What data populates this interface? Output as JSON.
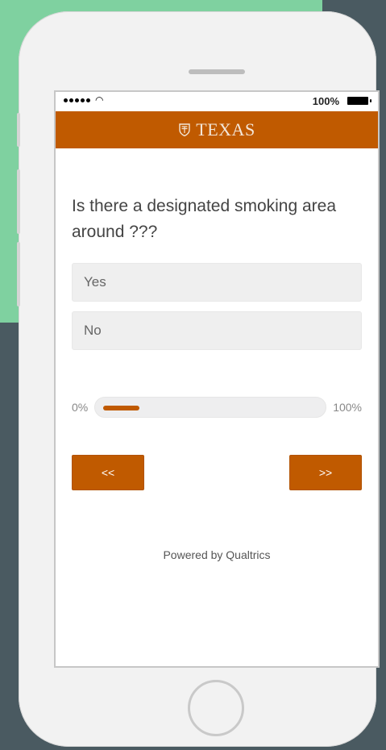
{
  "status_bar": {
    "battery_percent": "100%"
  },
  "header": {
    "brand": "TEXAS"
  },
  "question": {
    "text": "Is there a designated smoking area around ???"
  },
  "choices": [
    {
      "label": "Yes"
    },
    {
      "label": "No"
    }
  ],
  "progress": {
    "start_label": "0%",
    "end_label": "100%",
    "value": 0.17
  },
  "navigation": {
    "back_label": "<<",
    "next_label": ">>"
  },
  "footer": {
    "text": "Powered by Qualtrics"
  },
  "colors": {
    "brand_orange": "#c05a00"
  }
}
